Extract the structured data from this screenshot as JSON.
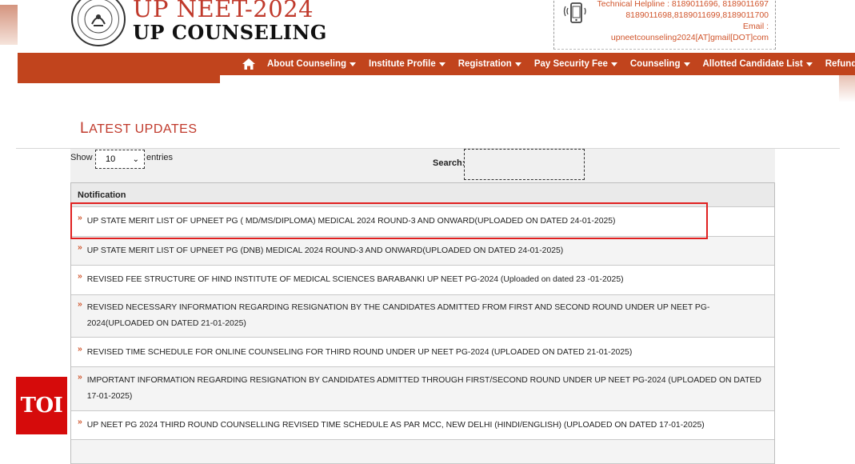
{
  "header": {
    "title": "UP NEET-2024",
    "subtitle": "UP COUNSELING",
    "helpline": {
      "line1": "Technical Helpline : 8189011696, 8189011697",
      "line2": "8189011698,8189011699,8189011700",
      "email_label": "Email :",
      "email_value": "upneetcounseling2024[AT]gmail[DOT]com"
    }
  },
  "nav": {
    "items": [
      {
        "label": "About Counseling"
      },
      {
        "label": "Institute Profile"
      },
      {
        "label": "Registration"
      },
      {
        "label": "Pay Security Fee"
      },
      {
        "label": "Counseling"
      },
      {
        "label": "Allotted Candidate List"
      },
      {
        "label": "Refund"
      }
    ]
  },
  "section": {
    "title_first": "L",
    "title_rest": "ATEST UPDATES"
  },
  "controls": {
    "show_label": "Show",
    "page_size": "10",
    "entries_label": "entries",
    "search_label": "Search:",
    "search_value": ""
  },
  "table": {
    "header": "Notification",
    "rows": [
      "UP STATE MERIT LIST OF UPNEET PG ( MD/MS/DIPLOMA) MEDICAL 2024 ROUND-3 AND ONWARD(UPLOADED ON DATED 24-01-2025)",
      "UP STATE MERIT LIST OF UPNEET PG (DNB) MEDICAL 2024 ROUND-3 AND ONWARD(UPLOADED ON DATED 24-01-2025)",
      "REVISED FEE STRUCTURE OF HIND INSTITUTE OF MEDICAL SCIENCES BARABANKI UP NEET PG-2024 (Uploaded on dated 23 -01-2025)",
      "REVISED NECESSARY INFORMATION REGARDING RESIGNATION BY THE CANDIDATES ADMITTED FROM FIRST AND SECOND ROUND UNDER UP NEET PG-2024(UPLOADED ON DATED 21-01-2025)",
      "REVISED TIME SCHEDULE FOR ONLINE COUNSELING FOR THIRD ROUND UNDER UP NEET PG-2024 (UPLOADED ON DATED 21-01-2025)",
      "IMPORTANT INFORMATION REGARDING RESIGNATION BY CANDIDATES ADMITTED THROUGH FIRST/SECOND ROUND UNDER UP NEET PG-2024 (UPLOADED ON DATED 17-01-2025)",
      "UP NEET PG 2024 THIRD ROUND COUNSELLING REVISED TIME SCHEDULE AS PAR MCC, NEW DELHI (HINDI/ENGLISH) (UPLOADED ON DATED 17-01-2025)"
    ],
    "row_marker": "»"
  },
  "watermark": {
    "label": "TOI"
  },
  "colors": {
    "brand_red": "#c0392b",
    "nav_orange": "#c1441d",
    "highlight_red": "#e02020",
    "toi_red": "#d60b0b"
  },
  "icons": [
    "emblem-logo",
    "phone-icon",
    "home-icon",
    "caret-down-icon",
    "double-chevron-icon"
  ]
}
